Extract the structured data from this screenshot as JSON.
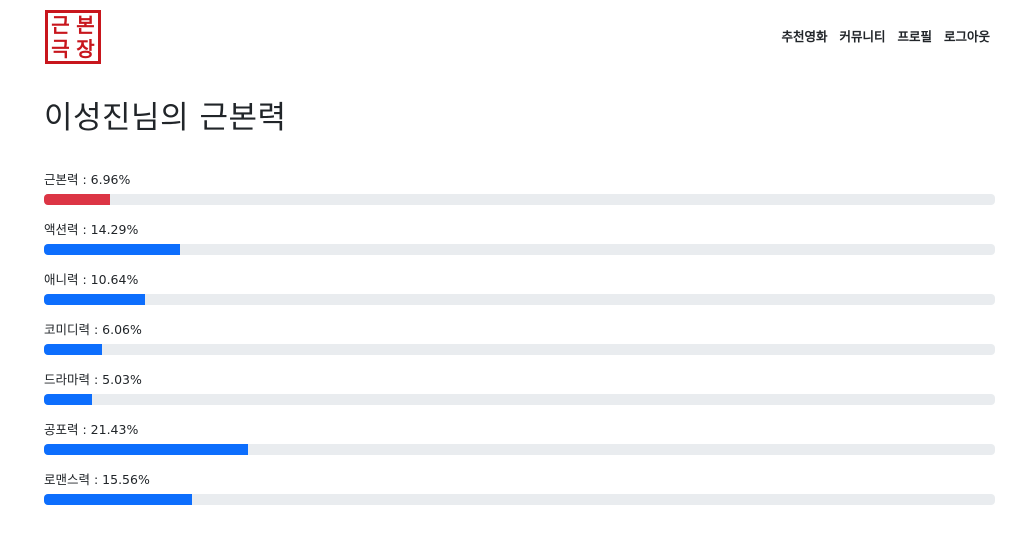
{
  "logo": {
    "chars": [
      "근",
      "본",
      "극",
      "장"
    ]
  },
  "nav": {
    "links": [
      "추천영화",
      "커뮤니티",
      "프로필",
      "로그아웃"
    ]
  },
  "title": "이성진님의 근본력",
  "stats": [
    {
      "label": "근본력 : 6.96%",
      "value": 6.96,
      "color": "#dc3545"
    },
    {
      "label": "액션력 : 14.29%",
      "value": 14.29,
      "color": "#0d6efd"
    },
    {
      "label": "애니력 : 10.64%",
      "value": 10.64,
      "color": "#0d6efd"
    },
    {
      "label": "코미디력 : 6.06%",
      "value": 6.06,
      "color": "#0d6efd"
    },
    {
      "label": "드라마력 : 5.03%",
      "value": 5.03,
      "color": "#0d6efd"
    },
    {
      "label": "공포력 : 21.43%",
      "value": 21.43,
      "color": "#0d6efd"
    },
    {
      "label": "로맨스력 : 15.56%",
      "value": 15.56,
      "color": "#0d6efd"
    }
  ]
}
